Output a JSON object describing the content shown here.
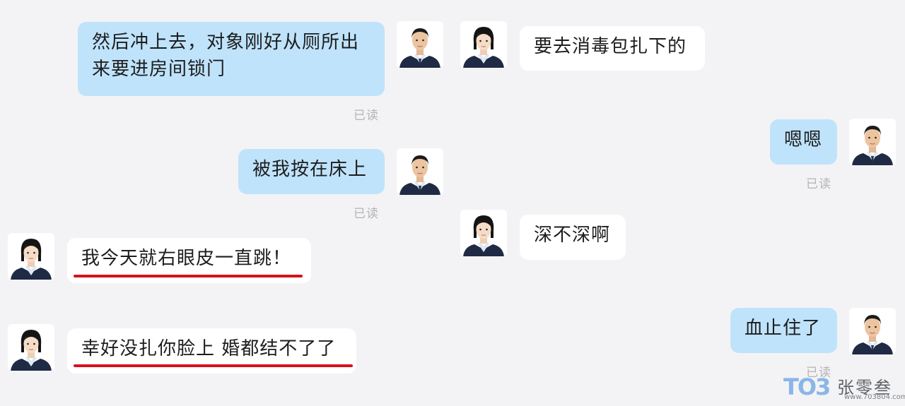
{
  "left_panel": {
    "messages": [
      {
        "side": "me",
        "text_line1": "然后冲上去，对象刚好从厕所出",
        "text_line2": "来要进房间锁门",
        "read": "已读"
      },
      {
        "side": "me",
        "text": "被我按在床上",
        "read": "已读"
      },
      {
        "side": "them",
        "text": "我今天就右眼皮一直跳！",
        "underlined": true
      },
      {
        "side": "them",
        "text": "幸好没扎你脸上 婚都结不了了",
        "underlined": true
      }
    ]
  },
  "right_panel": {
    "messages": [
      {
        "side": "them",
        "text": "要去消毒包扎下的"
      },
      {
        "side": "me",
        "text": "嗯嗯",
        "read": "已读"
      },
      {
        "side": "them",
        "text": "深不深啊"
      },
      {
        "side": "me",
        "text": "血止住了",
        "read": "已读"
      }
    ]
  },
  "watermark": {
    "logo_part1": "TO",
    "logo_part2": "3",
    "name": "张零叁",
    "url": "www.703804.com"
  },
  "colors": {
    "background": "#f3f3f5",
    "my_bubble": "#bfe3fb",
    "their_bubble": "#ffffff",
    "read_text": "#b4b4b8",
    "underline": "#d6121c",
    "uniform": "#1f2a44"
  },
  "icons": {
    "male_avatar": "male-officer-avatar-icon",
    "female_avatar": "female-officer-avatar-icon"
  }
}
